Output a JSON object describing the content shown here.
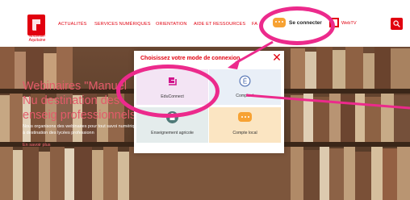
{
  "header": {
    "logo_lines": [
      "Région",
      "Nouvelle-",
      "Aquitaine"
    ],
    "nav": [
      {
        "label": "ACTUALITÉS"
      },
      {
        "label": "SERVICES NUMÉRIQUES"
      },
      {
        "label": "ORIENTATION"
      },
      {
        "label": "AIDE ET RESSOURCES"
      },
      {
        "label": "FA"
      }
    ],
    "connect_label": "Se connecter",
    "webtv_label": "WebTV"
  },
  "hero": {
    "title": "Webinaires \"Manuel Nu destination des enseig professionnels",
    "text": "Nous organisons des webinaires pour tout savoi numériques à destination des lycées professionn",
    "link": "En savoir plus"
  },
  "modal": {
    "title": "Choisissez votre mode de connexion",
    "close_label": "✕",
    "tiles": [
      {
        "label": "EduConnect",
        "icon": "educonnect-icon",
        "color": "#d1138c"
      },
      {
        "label": "Compte é",
        "icon": "e-badge-icon",
        "color": "#3b5fa8"
      },
      {
        "label": "Enseignement agricole",
        "icon": "agriculture-icon",
        "color": "#4f7a78"
      },
      {
        "label": "Compte local",
        "icon": "chat-bubble-icon",
        "color": "#f7a233"
      }
    ]
  },
  "colors": {
    "brand": "#e1000f",
    "annotation": "#ec2a8c"
  }
}
